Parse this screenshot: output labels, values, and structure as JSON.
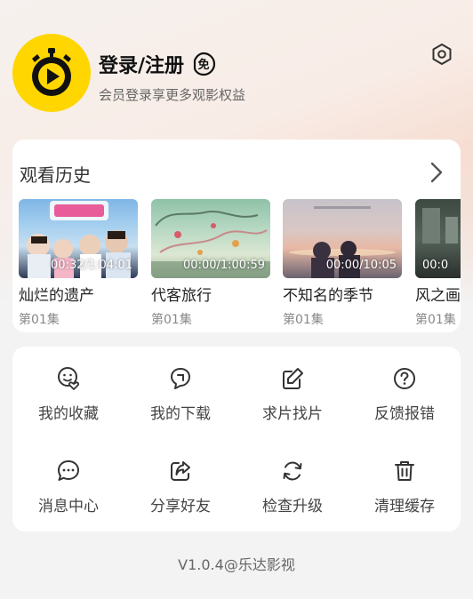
{
  "header": {
    "login_title": "登录/注册",
    "free_badge": "免",
    "subtitle": "会员登录享更多观影权益",
    "avatar_icon": "stopwatch-play-icon",
    "settings_icon": "settings-icon"
  },
  "history": {
    "title": "观看历史",
    "items": [
      {
        "name": "灿烂的遗产",
        "episode": "第01集",
        "time": "00:32/1:04:01"
      },
      {
        "name": "代客旅行",
        "episode": "第01集",
        "time": "00:00/1:00:59"
      },
      {
        "name": "不知名的季节",
        "episode": "第01集",
        "time": "00:00/10:05"
      },
      {
        "name": "风之画",
        "episode": "第01集",
        "time": "00:0"
      }
    ]
  },
  "menu": {
    "items": [
      {
        "label": "我的收藏",
        "icon": "favorite-icon"
      },
      {
        "label": "我的下载",
        "icon": "download-icon"
      },
      {
        "label": "求片找片",
        "icon": "edit-icon"
      },
      {
        "label": "反馈报错",
        "icon": "help-icon"
      },
      {
        "label": "消息中心",
        "icon": "message-icon"
      },
      {
        "label": "分享好友",
        "icon": "share-icon"
      },
      {
        "label": "检查升级",
        "icon": "refresh-icon"
      },
      {
        "label": "清理缓存",
        "icon": "trash-icon"
      }
    ]
  },
  "version": "V1.0.4@乐达影视",
  "colors": {
    "accent": "#ffd600",
    "background": "#f3f3f3"
  }
}
